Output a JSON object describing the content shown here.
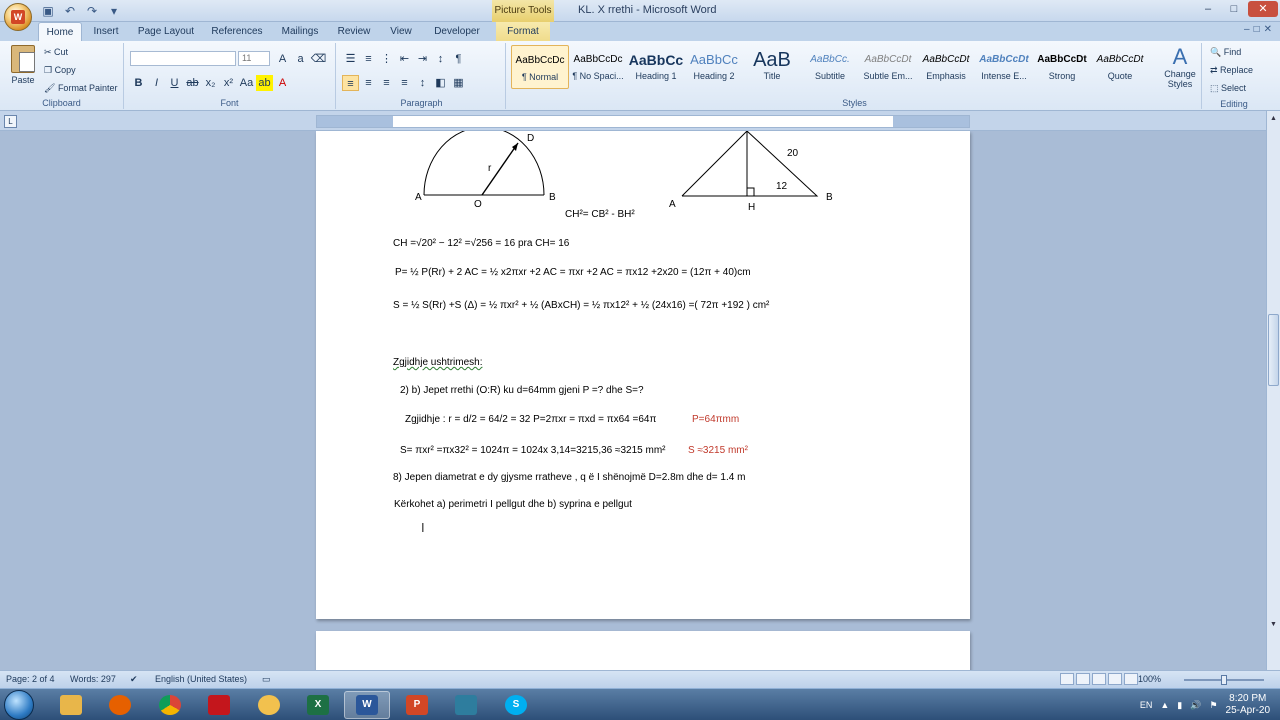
{
  "window": {
    "title": "KL. X  rrethi - Microsoft Word",
    "context_tab": "Picture Tools",
    "controls": [
      "–",
      "□",
      "✕"
    ],
    "ribbon_controls": [
      "–",
      "□",
      "✕"
    ]
  },
  "tabs": [
    "Home",
    "Insert",
    "Page Layout",
    "References",
    "Mailings",
    "Review",
    "View",
    "Developer",
    "Format"
  ],
  "ribbon": {
    "clipboard": {
      "paste": "Paste",
      "cut": "Cut",
      "copy": "Copy",
      "format_painter": "Format Painter",
      "label": "Clipboard"
    },
    "font": {
      "font_name": "",
      "font_size": "11",
      "label": "Font"
    },
    "paragraph": {
      "label": "Paragraph"
    },
    "styles": {
      "label": "Styles",
      "items": [
        {
          "sample": "AaBbCcDc",
          "name": "¶ Normal"
        },
        {
          "sample": "AaBbCcDc",
          "name": "¶ No Spaci..."
        },
        {
          "sample": "AaBbCc",
          "name": "Heading 1"
        },
        {
          "sample": "AaBbCc",
          "name": "Heading 2"
        },
        {
          "sample": "AaB",
          "name": "Title"
        },
        {
          "sample": "AaBbCc.",
          "name": "Subtitle"
        },
        {
          "sample": "AaBbCcDt",
          "name": "Subtle Em..."
        },
        {
          "sample": "AaBbCcDt",
          "name": "Emphasis"
        },
        {
          "sample": "AaBbCcDt",
          "name": "Intense E..."
        },
        {
          "sample": "AaBbCcDt",
          "name": "Strong"
        },
        {
          "sample": "AaBbCcDt",
          "name": "Quote"
        }
      ],
      "change_styles": "Change Styles"
    },
    "editing": {
      "find": "Find",
      "replace": "Replace",
      "select": "Select",
      "label": "Editing"
    }
  },
  "document": {
    "fig1": {
      "A": "A",
      "O": "O",
      "B": "B",
      "D": "D",
      "r": "r"
    },
    "fig2": {
      "A": "A",
      "H": "H",
      "B": "B",
      "side": "20",
      "base": "12"
    },
    "lines": {
      "ch_formula": "CH²= CB² - BH²",
      "ch_calc": "CH =√20² − 12² =√256 =  16  pra  CH= 16",
      "perimeter": "P= ½ P(Rr) + 2 AC = ½ x2πxr +2 AC = πxr +2 AC = πx12 +2x20 = (12π + 40)cm",
      "area": "S = ½ S(Rr)  +S (Δ)  =  ½ πxr² + ½ (ABxCH)  =  ½ πx12² + ½ (24x16)    =( 72π  +192 )  cm²",
      "heading": "Zgjidhje ushtrimesh:",
      "ex2": "2)          b)  Jepet   rrethi  (O:R)  ku    d=64mm       gjeni  P  =?  dhe  S=?",
      "sol": "Zgjidhje :   r = d/2  = 64/2  = 32     P=2πxr  = πxd = πx64 =64π",
      "sol_red": "P=64πmm",
      "area2": "S= πxr² =πx32² = 1024π = 1024x 3,14=3215,36 ≈3215 mm²",
      "area2_red": "S ≈3215 mm²",
      "ex8": "8)   Jepen    diametrat e dy gjysme rratheve ,  q ë  I  shënojmë  D=2.8m  dhe d= 1.4 m",
      "kerkohet": "Kërkohet  a)  perimetri I pellgut  dhe   b) syprina e pellgut"
    }
  },
  "status": {
    "page": "Page: 2 of 4",
    "words": "Words: 297",
    "language": "English (United States)",
    "zoom": "100%"
  },
  "taskbar": {
    "lang": "EN",
    "time": "8:20 PM",
    "date": "25-Apr-20"
  },
  "colors": {
    "red_text": "#c0392b",
    "accent": "#2b579a"
  }
}
